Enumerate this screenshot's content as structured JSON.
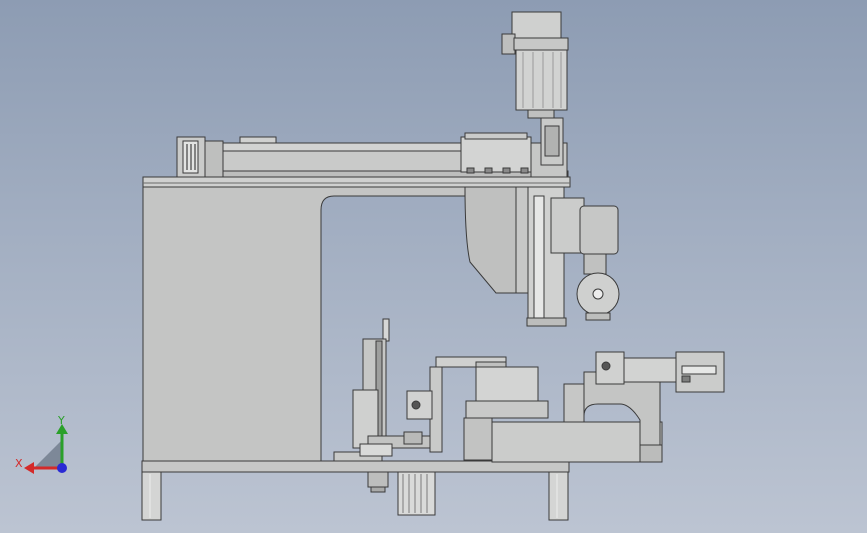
{
  "view": {
    "background_top": "#8d9cb3",
    "background_bottom": "#bcc4d2",
    "part_fill": "#c8c9c8",
    "part_edge": "#3a3a3a"
  },
  "triad": {
    "x_label": "X",
    "y_label": "Y",
    "x_color": "#d42a2a",
    "y_color": "#2aa02a",
    "z_color": "#2a2ad4",
    "icon": "coordinate-triad-icon"
  }
}
